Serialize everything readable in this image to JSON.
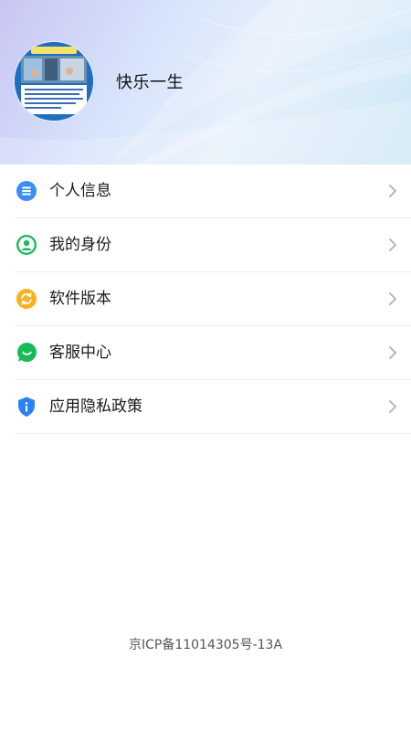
{
  "profile": {
    "username": "快乐一生"
  },
  "menu": {
    "items": [
      {
        "label": "个人信息",
        "icon": "list-icon",
        "color": "#3b8ef5"
      },
      {
        "label": "我的身份",
        "icon": "user-icon",
        "color": "#1fb75a"
      },
      {
        "label": "软件版本",
        "icon": "refresh-icon",
        "color": "#f7b21e"
      },
      {
        "label": "客服中心",
        "icon": "chat-icon",
        "color": "#17bb55"
      },
      {
        "label": "应用隐私政策",
        "icon": "shield-info-icon",
        "color": "#2d7ff5"
      }
    ]
  },
  "footer": {
    "icp": "京ICP备11014305号-13A"
  },
  "colors": {
    "chevron": "#b9b9b9",
    "divider": "#ededed",
    "text": "#1a1a1a"
  }
}
